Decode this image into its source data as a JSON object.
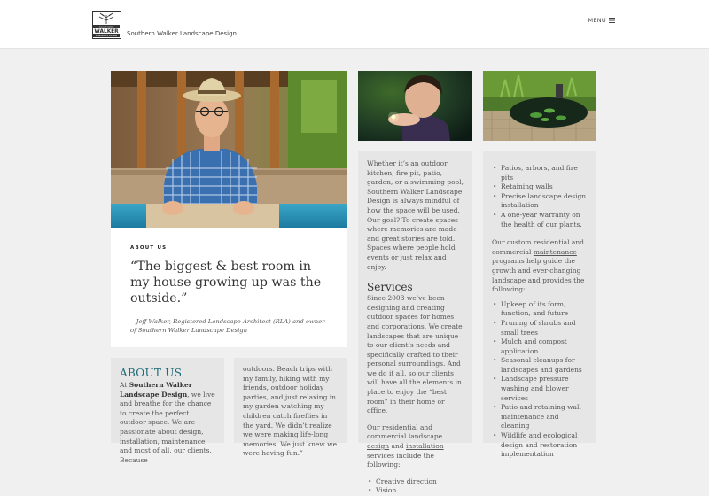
{
  "header": {
    "logo_text": "SOUTHERN WALKER LANDSCAPE DESIGN",
    "site_name": "Southern Walker Landscape Design",
    "menu_label": "MENU"
  },
  "hero_card": {
    "eyebrow": "ABOUT US",
    "quote": "“The biggest & best room in my house growing up was the outside.”",
    "cite": "—Jeff Walker, Registered Landscape Architect (RLA) and owner of Southern Walker Landscape Design"
  },
  "intro_card": {
    "paragraph": "Whether it’s an outdoor kitchen, fire pit, patio, garden, or a swimming pool, Southern Walker Landscape Design is always mindful of how the space will be used. Our goal? To create spaces where memories are made and great stories are told. Spaces where people hold events or just relax and enjoy.",
    "services_heading": "Services",
    "services_paragraph": "Since 2003 we’ve been designing and creating outdoor spaces for homes and corporations. We create landscapes that are unique to our client’s needs and specifically crafted to their personal surroundings. And we do it all, so our clients will have all the elements in place to enjoy the “best room” in their home or office.",
    "services_intro_pre": "Our residential and commercial landscape ",
    "link_design": "design",
    "and_word": " and",
    "link_installation": "installation",
    "services_intro_post": " services include the following:",
    "list": [
      "Creative direction",
      "Vision"
    ]
  },
  "right_card": {
    "list1": [
      "Patios, arbors, and fire pits",
      "Retaining walls",
      "Precise landscape design installation",
      "A one-year warranty on the health of our plants."
    ],
    "maint_pre": "Our custom residential and commercial ",
    "link_maintenance": "maintenance",
    "maint_post": " programs help guide the growth and ever-changing landscape and provides the following:",
    "list2": [
      "Upkeep of its form, function, and future",
      "Pruning of shrubs and small trees",
      "Mulch and compost application",
      "Seasonal cleanups for landscapes and gardens",
      "Landscape pressure washing and blower services",
      "Patio and retaining wall maintenance and cleaning",
      "Wildlife and ecological design and restoration implementation"
    ]
  },
  "about_card": {
    "heading": "ABOUT US",
    "pre": "At ",
    "bold": "Southern Walker Landscape Design",
    "post": ", we live and breathe for the chance to create the perfect outdoor space. We are passionate about design, installation, maintenance, and most of all, our clients. Because"
  },
  "story_card": {
    "paragraph": "outdoors. Beach trips with my family, hiking with my friends, outdoor holiday parties, and just relaxing in my garden watching my children catch fireflies in the yard. We didn’t realize we were making life-long memories. We just knew we were having fun.”"
  }
}
